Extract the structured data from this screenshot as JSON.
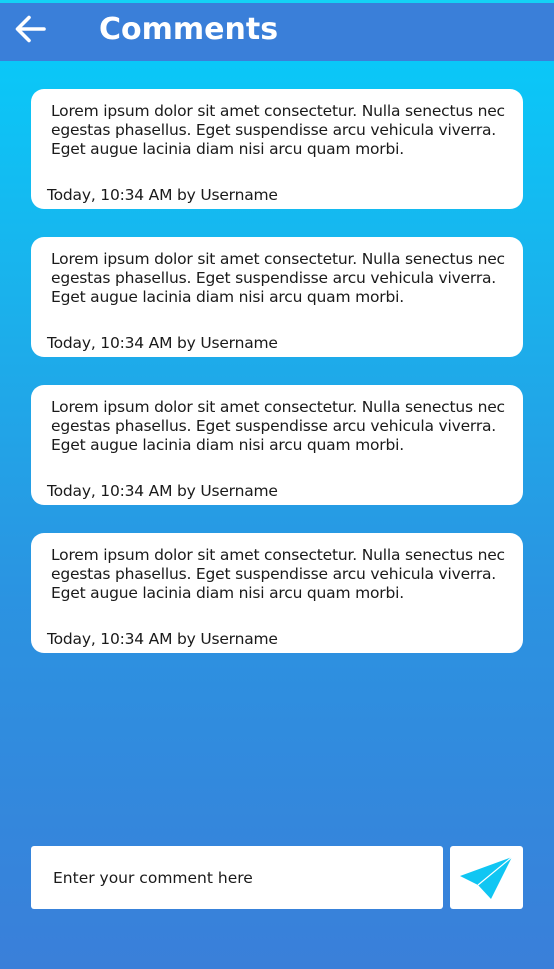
{
  "header": {
    "title": "Comments",
    "back_icon": "arrow-left-icon",
    "background_color": "#3a7fd9"
  },
  "comments": [
    {
      "text": "Lorem ipsum dolor sit amet consectetur. Nulla senectus nec egestas phasellus. Eget suspendisse arcu vehicula viverra. Eget augue lacinia diam nisi arcu quam morbi.",
      "meta": "Today, 10:34 AM by Username"
    },
    {
      "text": "Lorem ipsum dolor sit amet consectetur. Nulla senectus nec egestas phasellus. Eget suspendisse arcu vehicula viverra. Eget augue lacinia diam nisi arcu quam morbi.",
      "meta": "Today, 10:34 AM by Username"
    },
    {
      "text": "Lorem ipsum dolor sit amet consectetur. Nulla senectus nec egestas phasellus. Eget suspendisse arcu vehicula viverra. Eget augue lacinia diam nisi arcu quam morbi.",
      "meta": "Today, 10:34 AM by Username"
    },
    {
      "text": "Lorem ipsum dolor sit amet consectetur. Nulla senectus nec egestas phasellus. Eget suspendisse arcu vehicula viverra. Eget augue lacinia diam nisi arcu quam morbi.",
      "meta": "Today, 10:34 AM by Username"
    }
  ],
  "composer": {
    "placeholder": "Enter your comment here",
    "value": "",
    "send_icon": "send-icon",
    "send_icon_color": "#10c6f3"
  },
  "colors": {
    "gradient_top": "#06cdfb",
    "gradient_bottom": "#3a7fd9",
    "card": "#ffffff"
  }
}
